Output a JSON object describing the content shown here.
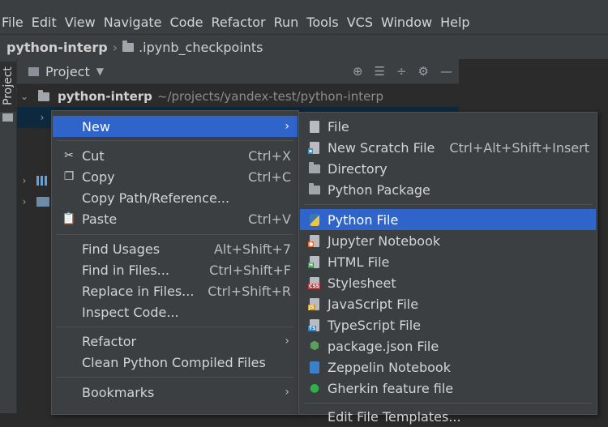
{
  "menubar": [
    "File",
    "Edit",
    "View",
    "Navigate",
    "Code",
    "Refactor",
    "Run",
    "Tools",
    "VCS",
    "Window",
    "Help"
  ],
  "navbar": {
    "root": "python-interp",
    "child": ".ipynb_checkpoints"
  },
  "tool_window": {
    "vertical_tab": "Project",
    "title": "Project"
  },
  "tree": {
    "root": "python-interp",
    "root_path": "~/projects/yandex-test/python-interp"
  },
  "context_menu": {
    "new": "New",
    "cut": "Cut",
    "cut_sc": "Ctrl+X",
    "copy": "Copy",
    "copy_sc": "Ctrl+C",
    "copy_path": "Copy Path/Reference...",
    "paste": "Paste",
    "paste_sc": "Ctrl+V",
    "find_usages": "Find Usages",
    "find_usages_sc": "Alt+Shift+7",
    "find_in_files": "Find in Files...",
    "find_in_files_sc": "Ctrl+Shift+F",
    "replace_in_files": "Replace in Files...",
    "replace_in_files_sc": "Ctrl+Shift+R",
    "inspect": "Inspect Code...",
    "refactor": "Refactor",
    "clean": "Clean Python Compiled Files",
    "bookmarks": "Bookmarks"
  },
  "submenu": {
    "file": "File",
    "scratch": "New Scratch File",
    "scratch_sc": "Ctrl+Alt+Shift+Insert",
    "directory": "Directory",
    "package": "Python Package",
    "python_file": "Python File",
    "jupyter": "Jupyter Notebook",
    "html": "HTML File",
    "stylesheet": "Stylesheet",
    "javascript": "JavaScript File",
    "typescript": "TypeScript File",
    "package_json": "package.json File",
    "zeppelin": "Zeppelin Notebook",
    "gherkin": "Gherkin feature file",
    "peek": "Edit File Templates..."
  },
  "colors": {
    "selection": "#2f65ca",
    "menu_bg": "#3c3f41",
    "editor_bg": "#2b2b2b"
  }
}
